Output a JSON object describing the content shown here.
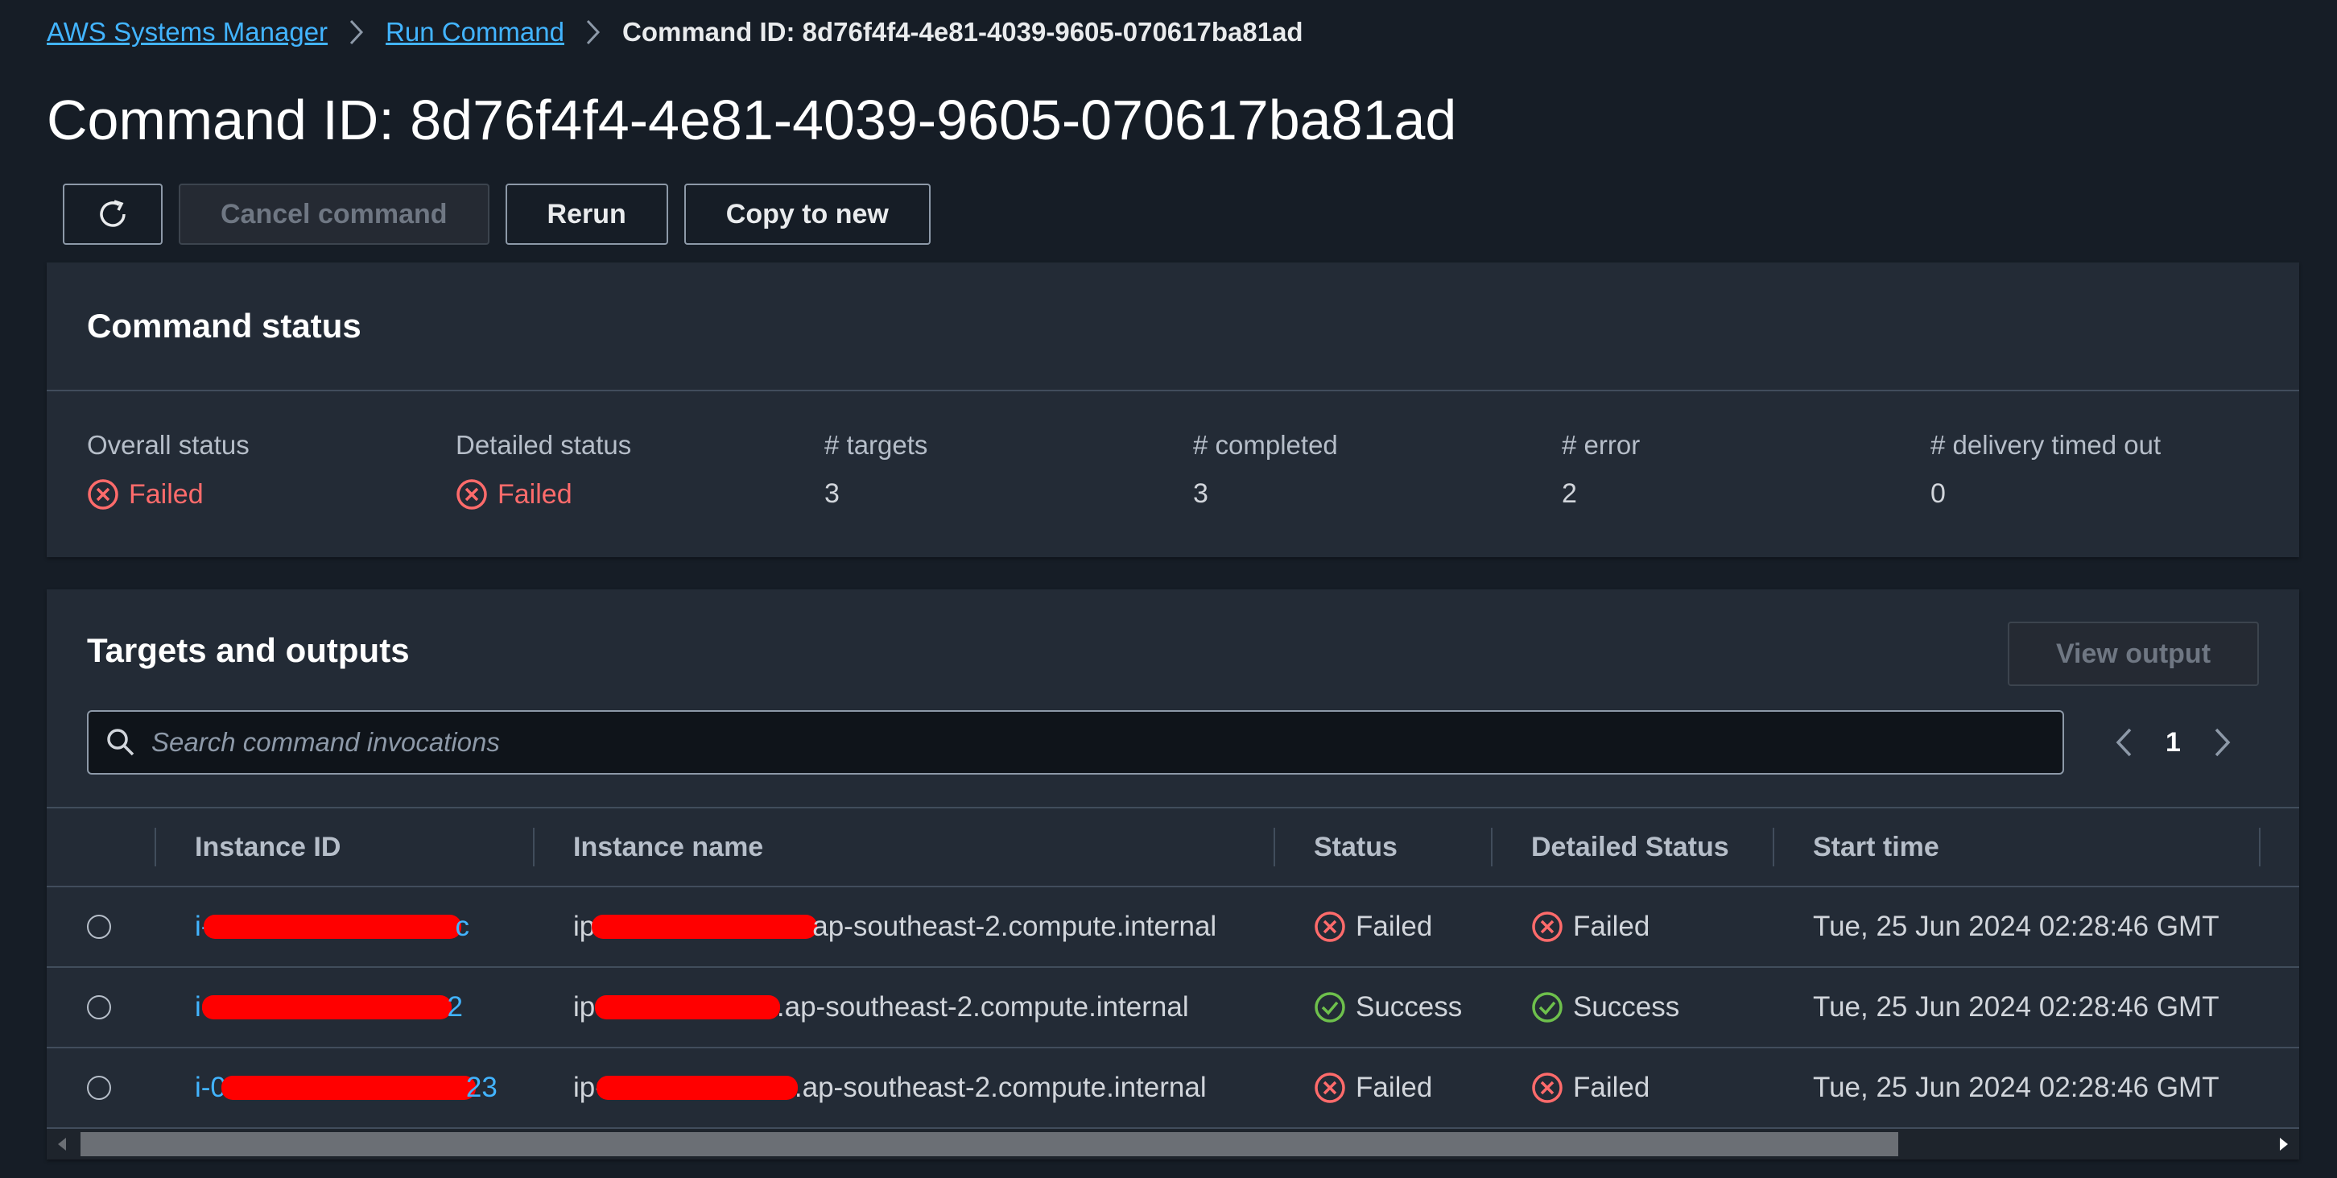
{
  "breadcrumb": {
    "items": [
      "AWS Systems Manager",
      "Run Command"
    ],
    "current": "Command ID: 8d76f4f4-4e81-4039-9605-070617ba81ad"
  },
  "page_title": "Command ID: 8d76f4f4-4e81-4039-9605-070617ba81ad",
  "toolbar": {
    "refresh_icon": "refresh-icon",
    "cancel_label": "Cancel command",
    "rerun_label": "Rerun",
    "copy_label": "Copy to new"
  },
  "command_status": {
    "title": "Command status",
    "fields": [
      {
        "label": "Overall status",
        "value": "Failed",
        "status": "failed"
      },
      {
        "label": "Detailed status",
        "value": "Failed",
        "status": "failed"
      },
      {
        "label": "# targets",
        "value": "3"
      },
      {
        "label": "# completed",
        "value": "3"
      },
      {
        "label": "# error",
        "value": "2"
      },
      {
        "label": "# delivery timed out",
        "value": "0"
      }
    ]
  },
  "targets": {
    "title": "Targets and outputs",
    "view_output_label": "View output",
    "search_placeholder": "Search command invocations",
    "page_number": "1",
    "columns": [
      "Instance ID",
      "Instance name",
      "Status",
      "Detailed Status",
      "Start time"
    ],
    "rows": [
      {
        "id_prefix": "i-",
        "id_suffix": "c",
        "name_prefix": "ip",
        "name_suffix": "ap-southeast-2.compute.internal",
        "status": "Failed",
        "detailed_status": "Failed",
        "start_time": "Tue, 25 Jun 2024 02:28:46 GMT"
      },
      {
        "id_prefix": "i-",
        "id_suffix": "2",
        "name_prefix": "ip-",
        "name_suffix": ".ap-southeast-2.compute.internal",
        "status": "Success",
        "detailed_status": "Success",
        "start_time": "Tue, 25 Jun 2024 02:28:46 GMT"
      },
      {
        "id_prefix": "i-0",
        "id_suffix": "23",
        "name_prefix": "ip-",
        "name_suffix": ".ap-southeast-2.compute.internal",
        "status": "Failed",
        "detailed_status": "Failed",
        "start_time": "Tue, 25 Jun 2024 02:28:46 GMT"
      }
    ]
  },
  "colors": {
    "background": "#161d26",
    "panel": "#232b36",
    "link": "#42b4ff",
    "failed": "#ff6b6b",
    "success": "#6ec04c",
    "redaction": "#ff0000"
  }
}
